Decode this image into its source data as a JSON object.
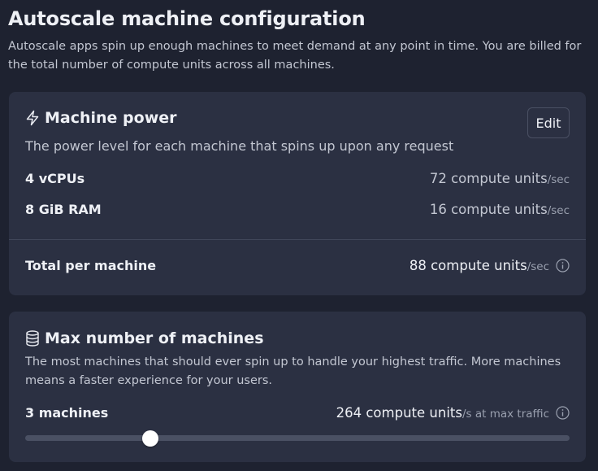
{
  "page": {
    "title": "Autoscale machine configuration",
    "description": "Autoscale apps spin up enough machines to meet demand at any point in time. You are billed for the total number of compute units across all machines."
  },
  "machine_power": {
    "icon": "lightning-icon",
    "title": "Machine power",
    "subtitle": "The power level for each machine that spins up upon any request",
    "edit_label": "Edit",
    "rows": [
      {
        "label": "4 vCPUs",
        "value": "72 compute units",
        "unit": "/sec"
      },
      {
        "label": "8 GiB RAM",
        "value": "16 compute units",
        "unit": "/sec"
      }
    ],
    "total": {
      "label": "Total per machine",
      "value": "88 compute units",
      "unit": "/sec",
      "icon": "info-icon"
    }
  },
  "max_machines": {
    "icon": "database-icon",
    "title": "Max number of machines",
    "subtitle": "The most machines that should ever spin up to handle your highest traffic. More machines means a faster experience for your users.",
    "count_label": "3 machines",
    "value": "264 compute units",
    "unit": "/s at max traffic",
    "info_icon": "info-icon",
    "slider_fraction": 0.23
  },
  "colors": {
    "background": "#1e2230",
    "card": "#2b3042",
    "text_primary": "#eef0f5",
    "text_secondary": "#c3c7d2",
    "text_muted": "#9aa0af"
  }
}
